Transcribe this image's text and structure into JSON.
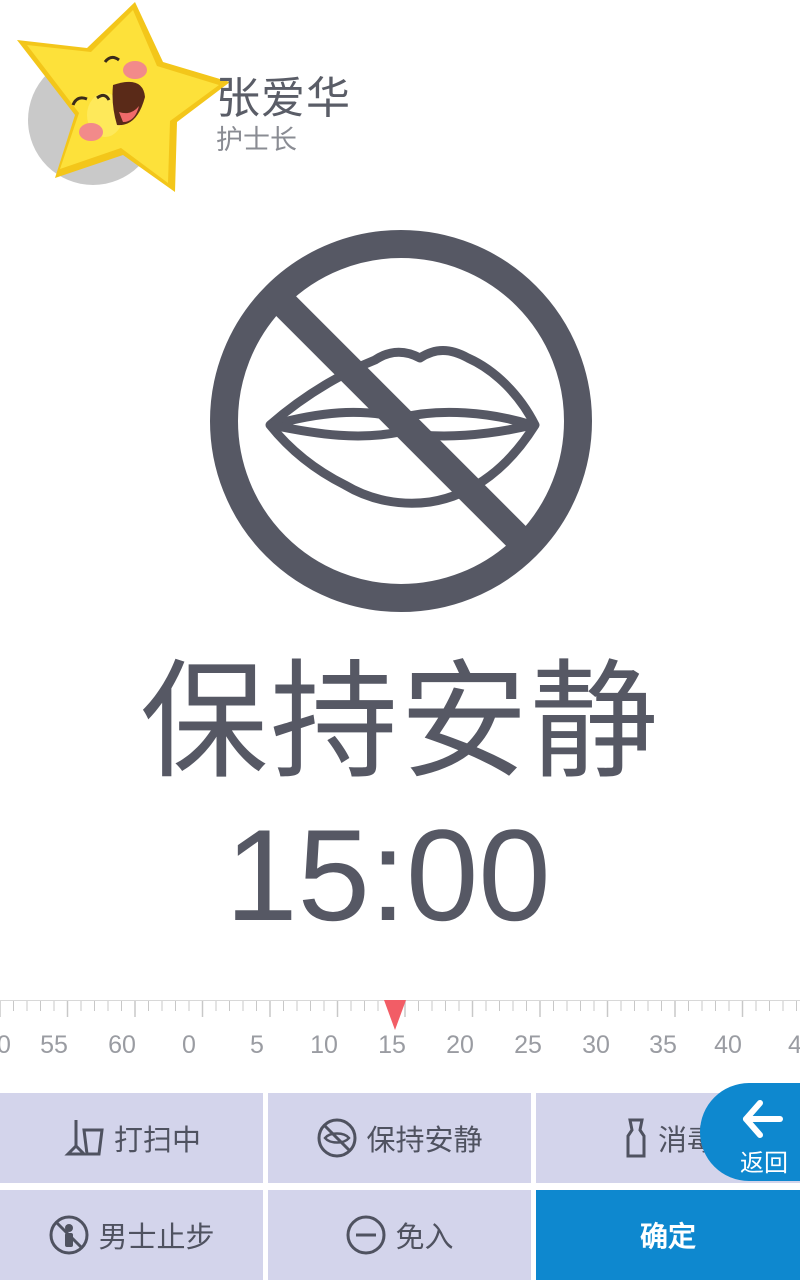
{
  "user": {
    "name": "张爱华",
    "role": "护士长"
  },
  "status": {
    "title": "保持安静",
    "time": "15:00",
    "icon": "no-talking-icon"
  },
  "ruler": {
    "labels": [
      "0",
      "55",
      "60",
      "0",
      "5",
      "10",
      "15",
      "20",
      "25",
      "30",
      "35",
      "40",
      "4"
    ],
    "selected": "15"
  },
  "buttons": {
    "cleaning": "打扫中",
    "quiet": "保持安静",
    "disinfect": "消毒",
    "no_men": "男士止步",
    "no_entry": "免入",
    "confirm": "确定",
    "back": "返回"
  },
  "colors": {
    "primary": "#0e88cf",
    "button_bg": "#d3d4eb",
    "text": "#565864",
    "pointer": "#f25d66"
  }
}
